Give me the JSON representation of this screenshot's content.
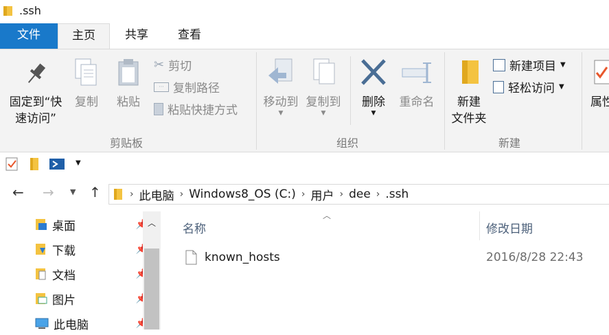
{
  "window": {
    "title": ".ssh"
  },
  "tabs": [
    {
      "label": "文件"
    },
    {
      "label": "主页"
    },
    {
      "label": "共享"
    },
    {
      "label": "查看"
    }
  ],
  "ribbon": {
    "clipboard": {
      "pin_label_1": "固定到“快",
      "pin_label_2": "速访问”",
      "copy": "复制",
      "paste": "粘贴",
      "cut": "剪切",
      "copy_path": "复制路径",
      "paste_shortcut": "粘贴快捷方式",
      "group": "剪贴板"
    },
    "organize": {
      "move_to": "移动到",
      "copy_to": "复制到",
      "delete": "删除",
      "rename": "重命名",
      "group": "组织"
    },
    "new": {
      "new_folder_1": "新建",
      "new_folder_2": "文件夹",
      "new_item": "新建项目",
      "easy_access": "轻松访问",
      "group": "新建"
    },
    "open": {
      "properties": "属性"
    }
  },
  "address": {
    "crumbs": [
      "此电脑",
      "Windows8_OS (C:)",
      "用户",
      "dee",
      ".ssh"
    ]
  },
  "nav_pane": {
    "items": [
      {
        "label": "桌面"
      },
      {
        "label": "下载"
      },
      {
        "label": "文档"
      },
      {
        "label": "图片"
      },
      {
        "label": "此电脑"
      }
    ]
  },
  "file_list": {
    "col_name": "名称",
    "col_modified": "修改日期",
    "rows": [
      {
        "name": "known_hosts",
        "modified": "2016/8/28 22:43"
      }
    ]
  },
  "colors": {
    "accent": "#1979ca",
    "ribbon_bg": "#f3f3f3",
    "folder": "#f4c341"
  }
}
